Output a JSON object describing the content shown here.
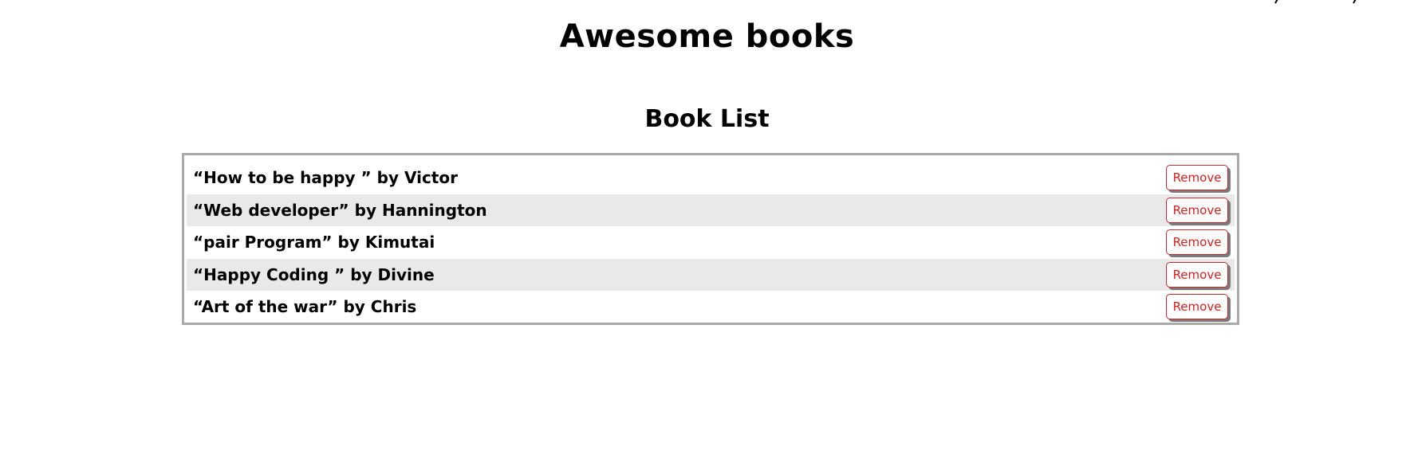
{
  "header": {
    "title": "Awesome books"
  },
  "main": {
    "section_title": "Book List",
    "books": [
      {
        "text": "“How to be happy ” by Victor",
        "remove_label": "Remove"
      },
      {
        "text": "“Web developer” by Hannington",
        "remove_label": "Remove"
      },
      {
        "text": "“pair Program” by Kimutai",
        "remove_label": "Remove"
      },
      {
        "text": "“Happy Coding ” by Divine",
        "remove_label": "Remove"
      },
      {
        "text": "“Art of the war” by Chris",
        "remove_label": "Remove"
      }
    ]
  },
  "colors": {
    "remove_button_text": "#e01b1b",
    "remove_button_border": "#cc2a2a",
    "alt_row_background": "#e9e9e9",
    "list_border": "#a9a9a9"
  }
}
